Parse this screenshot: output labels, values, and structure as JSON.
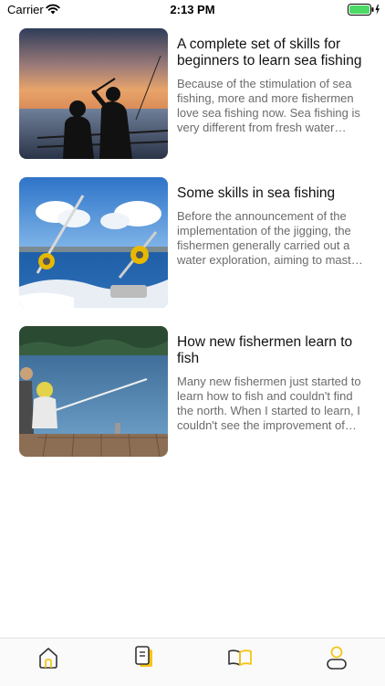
{
  "status_bar": {
    "carrier": "Carrier",
    "time": "2:13 PM",
    "battery_color": "#4cd964"
  },
  "articles": [
    {
      "title": "A complete set of skills for beginners to learn sea fishing",
      "excerpt": "Because of the stimulation of sea fishing, more and more fishermen love sea fishing now. Sea fishing is very different from fresh water fishing. How can new people quickly master the skills?",
      "image": "sunset-fishermen-silhouette"
    },
    {
      "title": "Some skills in sea fishing",
      "excerpt": "Before the announcement of the implementation of the jigging, the fishermen generally carried out a water exploration, aiming to master the terrain of the sea bottom and the water depth.",
      "image": "boat-fishing-rods-ocean"
    },
    {
      "title": "How new fishermen learn to fish",
      "excerpt": "Many new fishermen just started to learn how to fish and couldn't find the north. When I started to learn, I couldn't see the improvement of technology. I was very anxious.",
      "image": "child-fishing-on-dock"
    }
  ],
  "tab_bar": {
    "accent_color": "#f5c518",
    "tabs": [
      {
        "icon": "home-icon"
      },
      {
        "icon": "notes-icon"
      },
      {
        "icon": "book-icon"
      },
      {
        "icon": "profile-icon"
      }
    ]
  }
}
